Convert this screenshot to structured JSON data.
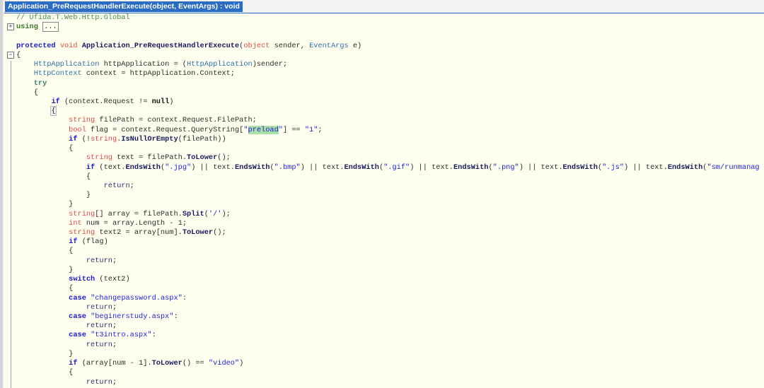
{
  "tab": {
    "title": "Application_PreRequestHandlerExecute(object, EventArgs) : void"
  },
  "gutter": {
    "expand_icon": "+",
    "collapse_icon": "−"
  },
  "colors": {
    "keyword": "#1a1ad0",
    "type": "#e04848",
    "class": "#2e6fa6",
    "string": "#2222d8",
    "comment": "#4a8a4a",
    "background": "#fffff0",
    "tab": "#2a6cc4",
    "highlight": "#a8e0a8"
  },
  "code": {
    "lines": [
      {
        "tokens": [
          [
            "g",
            "// Ufida.T.Web.Http.Global"
          ]
        ]
      },
      {
        "tokens": [
          [
            "u",
            "using"
          ],
          [
            "p",
            " "
          ],
          [
            "box",
            "..."
          ]
        ]
      },
      {
        "tokens": []
      },
      {
        "tokens": [
          [
            "k",
            "protected"
          ],
          [
            "p",
            " "
          ],
          [
            "t",
            "void"
          ],
          [
            "p",
            " "
          ],
          [
            "m",
            "Application_PreRequestHandlerExecute"
          ],
          [
            "p",
            "("
          ],
          [
            "t",
            "object"
          ],
          [
            "p",
            " sender, "
          ],
          [
            "c",
            "EventArgs"
          ],
          [
            "p",
            " e)"
          ]
        ]
      },
      {
        "tokens": [
          [
            "p",
            "{"
          ]
        ]
      },
      {
        "tokens": [
          [
            "p",
            "    "
          ],
          [
            "c",
            "HttpApplication"
          ],
          [
            "p",
            " httpApplication = ("
          ],
          [
            "c",
            "HttpApplication"
          ],
          [
            "p",
            ")sender;"
          ]
        ]
      },
      {
        "tokens": [
          [
            "p",
            "    "
          ],
          [
            "c",
            "HttpContext"
          ],
          [
            "p",
            " context = httpApplication.Context;"
          ]
        ]
      },
      {
        "tokens": [
          [
            "p",
            "    "
          ],
          [
            "y",
            "try"
          ]
        ]
      },
      {
        "tokens": [
          [
            "p",
            "    {"
          ]
        ]
      },
      {
        "tokens": [
          [
            "p",
            "        "
          ],
          [
            "k",
            "if"
          ],
          [
            "p",
            " (context.Request != "
          ],
          [
            "b",
            "null"
          ],
          [
            "p",
            ")"
          ]
        ]
      },
      {
        "tokens": [
          [
            "p",
            "        "
          ],
          [
            "bracehl",
            "{"
          ]
        ]
      },
      {
        "tokens": [
          [
            "p",
            "            "
          ],
          [
            "t",
            "string"
          ],
          [
            "p",
            " filePath = context.Request.FilePath;"
          ]
        ]
      },
      {
        "tokens": [
          [
            "p",
            "            "
          ],
          [
            "t",
            "bool"
          ],
          [
            "p",
            " flag = context.Request.QueryString["
          ],
          [
            "s",
            "\""
          ],
          [
            "h",
            "preload"
          ],
          [
            "s",
            "\""
          ],
          [
            "p",
            "] == "
          ],
          [
            "s",
            "\"1\""
          ],
          [
            "p",
            ";"
          ]
        ]
      },
      {
        "tokens": [
          [
            "p",
            "            "
          ],
          [
            "k",
            "if"
          ],
          [
            "p",
            " (!"
          ],
          [
            "t",
            "string"
          ],
          [
            "p",
            "."
          ],
          [
            "m",
            "IsNullOrEmpty"
          ],
          [
            "p",
            "(filePath))"
          ]
        ]
      },
      {
        "tokens": [
          [
            "p",
            "            {"
          ]
        ]
      },
      {
        "tokens": [
          [
            "p",
            "                "
          ],
          [
            "t",
            "string"
          ],
          [
            "p",
            " text = filePath."
          ],
          [
            "m",
            "ToLower"
          ],
          [
            "p",
            "();"
          ]
        ]
      },
      {
        "tokens": [
          [
            "p",
            "                "
          ],
          [
            "k",
            "if"
          ],
          [
            "p",
            " (text."
          ],
          [
            "m",
            "EndsWith"
          ],
          [
            "p",
            "("
          ],
          [
            "s",
            "\".jpg\""
          ],
          [
            "p",
            ") || text."
          ],
          [
            "m",
            "EndsWith"
          ],
          [
            "p",
            "("
          ],
          [
            "s",
            "\".bmp\""
          ],
          [
            "p",
            ") || text."
          ],
          [
            "m",
            "EndsWith"
          ],
          [
            "p",
            "("
          ],
          [
            "s",
            "\".gif\""
          ],
          [
            "p",
            ") || text."
          ],
          [
            "m",
            "EndsWith"
          ],
          [
            "p",
            "("
          ],
          [
            "s",
            "\".png\""
          ],
          [
            "p",
            ") || text."
          ],
          [
            "m",
            "EndsWith"
          ],
          [
            "p",
            "("
          ],
          [
            "s",
            "\".js\""
          ],
          [
            "p",
            ") || text."
          ],
          [
            "m",
            "EndsWith"
          ],
          [
            "p",
            "("
          ],
          [
            "s",
            "\"sm/runmanag"
          ]
        ]
      },
      {
        "tokens": [
          [
            "p",
            "                {"
          ]
        ]
      },
      {
        "tokens": [
          [
            "p",
            "                    "
          ],
          [
            "r",
            "return"
          ],
          [
            "p",
            ";"
          ]
        ]
      },
      {
        "tokens": [
          [
            "p",
            "                }"
          ]
        ]
      },
      {
        "tokens": [
          [
            "p",
            "            }"
          ]
        ]
      },
      {
        "tokens": [
          [
            "p",
            "            "
          ],
          [
            "t",
            "string"
          ],
          [
            "p",
            "[] array = filePath."
          ],
          [
            "m",
            "Split"
          ],
          [
            "p",
            "("
          ],
          [
            "s",
            "'/'"
          ],
          [
            "p",
            ");"
          ]
        ]
      },
      {
        "tokens": [
          [
            "p",
            "            "
          ],
          [
            "t",
            "int"
          ],
          [
            "p",
            " num = array.Length - 1;"
          ]
        ]
      },
      {
        "tokens": [
          [
            "p",
            "            "
          ],
          [
            "t",
            "string"
          ],
          [
            "p",
            " text2 = array[num]."
          ],
          [
            "m",
            "ToLower"
          ],
          [
            "p",
            "();"
          ]
        ]
      },
      {
        "tokens": [
          [
            "p",
            "            "
          ],
          [
            "k",
            "if"
          ],
          [
            "p",
            " (flag)"
          ]
        ]
      },
      {
        "tokens": [
          [
            "p",
            "            {"
          ]
        ]
      },
      {
        "tokens": [
          [
            "p",
            "                "
          ],
          [
            "r",
            "return"
          ],
          [
            "p",
            ";"
          ]
        ]
      },
      {
        "tokens": [
          [
            "p",
            "            }"
          ]
        ]
      },
      {
        "tokens": [
          [
            "p",
            "            "
          ],
          [
            "k",
            "switch"
          ],
          [
            "p",
            " (text2)"
          ]
        ]
      },
      {
        "tokens": [
          [
            "p",
            "            {"
          ]
        ]
      },
      {
        "tokens": [
          [
            "p",
            "            "
          ],
          [
            "k",
            "case"
          ],
          [
            "p",
            " "
          ],
          [
            "s",
            "\"changepassword.aspx\""
          ],
          [
            "p",
            ":"
          ]
        ]
      },
      {
        "tokens": [
          [
            "p",
            "                "
          ],
          [
            "r",
            "return"
          ],
          [
            "p",
            ";"
          ]
        ]
      },
      {
        "tokens": [
          [
            "p",
            "            "
          ],
          [
            "k",
            "case"
          ],
          [
            "p",
            " "
          ],
          [
            "s",
            "\"beginerstudy.aspx\""
          ],
          [
            "p",
            ":"
          ]
        ]
      },
      {
        "tokens": [
          [
            "p",
            "                "
          ],
          [
            "r",
            "return"
          ],
          [
            "p",
            ";"
          ]
        ]
      },
      {
        "tokens": [
          [
            "p",
            "            "
          ],
          [
            "k",
            "case"
          ],
          [
            "p",
            " "
          ],
          [
            "s",
            "\"t3intro.aspx\""
          ],
          [
            "p",
            ":"
          ]
        ]
      },
      {
        "tokens": [
          [
            "p",
            "                "
          ],
          [
            "r",
            "return"
          ],
          [
            "p",
            ";"
          ]
        ]
      },
      {
        "tokens": [
          [
            "p",
            "            }"
          ]
        ]
      },
      {
        "tokens": [
          [
            "p",
            "            "
          ],
          [
            "k",
            "if"
          ],
          [
            "p",
            " (array[num - 1]."
          ],
          [
            "m",
            "ToLower"
          ],
          [
            "p",
            "() == "
          ],
          [
            "s",
            "\"video\""
          ],
          [
            "p",
            ")"
          ]
        ]
      },
      {
        "tokens": [
          [
            "p",
            "            {"
          ]
        ]
      },
      {
        "tokens": [
          [
            "p",
            "                "
          ],
          [
            "r",
            "return"
          ],
          [
            "p",
            ";"
          ]
        ]
      }
    ]
  }
}
